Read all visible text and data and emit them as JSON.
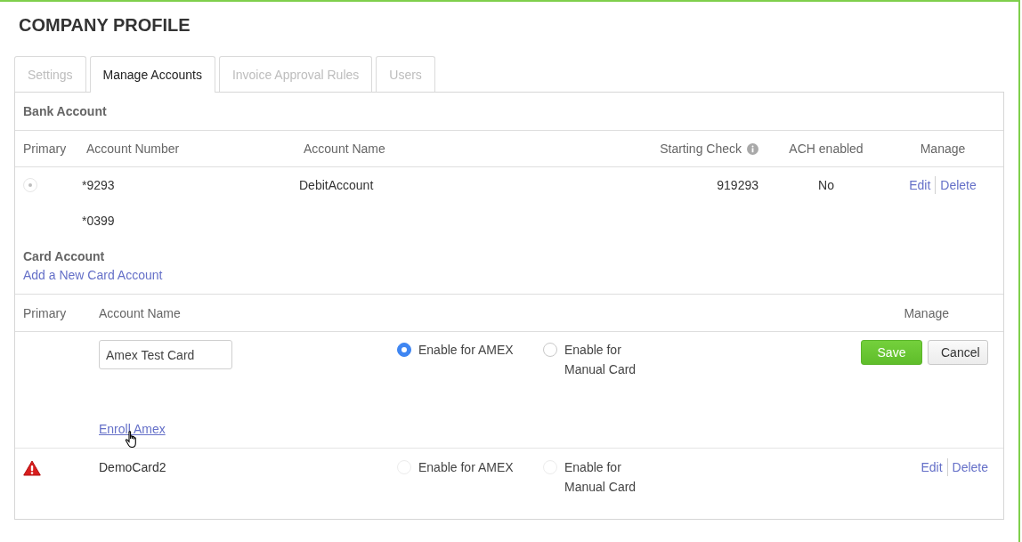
{
  "page": {
    "title": "COMPANY PROFILE"
  },
  "tabs": [
    {
      "label": "Settings",
      "selected": false
    },
    {
      "label": "Manage Accounts",
      "selected": true
    },
    {
      "label": "Invoice Approval Rules",
      "selected": false
    },
    {
      "label": "Users",
      "selected": false
    }
  ],
  "bank_account": {
    "title": "Bank Account",
    "columns": [
      {
        "label": "Primary"
      },
      {
        "label": "Account Number"
      },
      {
        "label": "Account Name"
      },
      {
        "label": "Starting Check",
        "info": true
      },
      {
        "label": "ACH enabled"
      },
      {
        "label": "Manage"
      }
    ],
    "rows": [
      {
        "primary": true,
        "account_number": "*9293",
        "account_name": "DebitAccount",
        "starting_check": "919293",
        "ach_enabled": "No",
        "actions": [
          "Edit",
          "Delete"
        ]
      },
      {
        "account_number": "*0399"
      }
    ]
  },
  "card_account": {
    "title": "Card Account",
    "add_link": "Add a New Card Account",
    "columns": [
      "Primary",
      "Account Name",
      "Manage"
    ],
    "rows": [
      {
        "kind": "edit",
        "account_name": "Amex Test Card",
        "options": [
          {
            "label": "Enable for AMEX",
            "selected": true,
            "disabled": false
          },
          {
            "label": "Enable for Manual Card",
            "selected": false,
            "disabled": false
          }
        ],
        "buttons": [
          {
            "label": "Save",
            "kind": "primary"
          },
          {
            "label": "Cancel",
            "kind": "default"
          }
        ],
        "enroll_link": "Enroll Amex"
      },
      {
        "kind": "view",
        "warning": true,
        "account_name": "DemoCard2",
        "options": [
          {
            "label": "Enable for AMEX",
            "selected": false,
            "disabled": true
          },
          {
            "label": "Enable for Manual Card",
            "selected": false,
            "disabled": true
          }
        ],
        "actions": [
          "Edit",
          "Delete"
        ]
      }
    ]
  }
}
